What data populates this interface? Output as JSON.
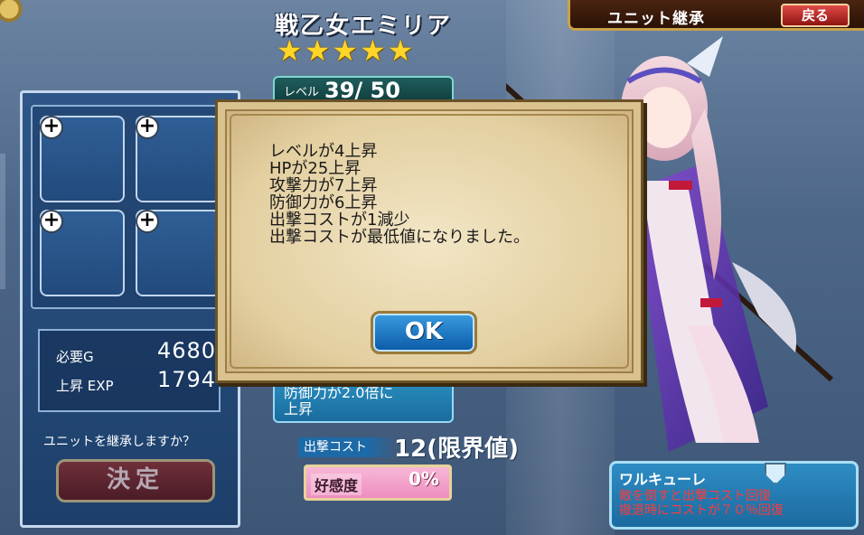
{
  "header": {
    "unit_name": "戦乙女エミリア",
    "stars": [
      "★",
      "★",
      "★",
      "★",
      "★"
    ],
    "level_label": "レベル",
    "level_value": "39/ 50"
  },
  "title_bar": {
    "title": "ユニット継承",
    "back_label": "戻る"
  },
  "left_panel": {
    "slots": [
      "+",
      "+",
      "+",
      "+"
    ],
    "required_g_label": "必要G",
    "required_g_value": "4680",
    "exp_label": "上昇 EXP",
    "exp_value": "1794",
    "question": "ユニットを継承しますか？",
    "decide_label": "決定"
  },
  "stats": {
    "skill_line1": "防御力が2.0倍に",
    "skill_line2": "上昇",
    "sortie_label": "出撃コスト",
    "sortie_value": "12(限界値)",
    "affection_label": "好感度",
    "affection_value": "0%"
  },
  "class_info": {
    "name": "ワルキューレ",
    "desc1": "敵を倒すと出撃コスト回復",
    "desc2": "撤退時にコストが７０％回復"
  },
  "modal": {
    "lines": [
      "レベルが4上昇",
      "HPが25上昇",
      "攻撃力が7上昇",
      "防御力が6上昇",
      "出撃コストが1減少",
      "出撃コストが最低値になりました。"
    ],
    "ok_label": "OK"
  },
  "colors": {
    "accent_gold": "#c9a14a",
    "panel_blue": "#2e5687",
    "class_desc_red": "#ff3a3a"
  }
}
